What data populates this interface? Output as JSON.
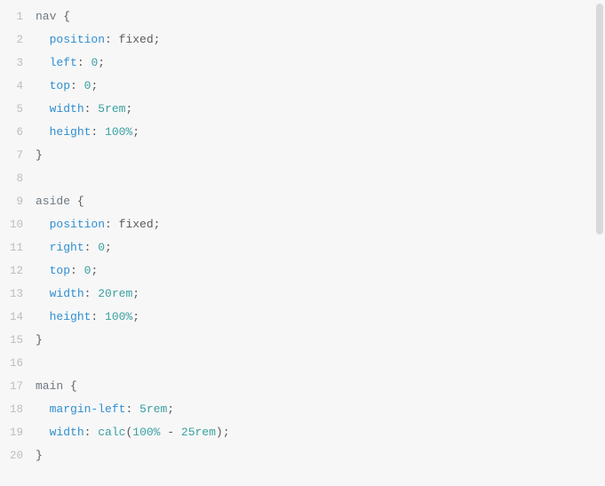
{
  "lines": [
    {
      "num": "1",
      "tokens": [
        {
          "t": "nav",
          "c": "tok-selector"
        },
        {
          "t": " {",
          "c": "tok-punc"
        }
      ]
    },
    {
      "num": "2",
      "tokens": [
        {
          "t": "  ",
          "c": ""
        },
        {
          "t": "position",
          "c": "tok-prop"
        },
        {
          "t": ": ",
          "c": "tok-punc"
        },
        {
          "t": "fixed",
          "c": "tok-value"
        },
        {
          "t": ";",
          "c": "tok-punc"
        }
      ]
    },
    {
      "num": "3",
      "tokens": [
        {
          "t": "  ",
          "c": ""
        },
        {
          "t": "left",
          "c": "tok-prop"
        },
        {
          "t": ": ",
          "c": "tok-punc"
        },
        {
          "t": "0",
          "c": "tok-number"
        },
        {
          "t": ";",
          "c": "tok-punc"
        }
      ]
    },
    {
      "num": "4",
      "tokens": [
        {
          "t": "  ",
          "c": ""
        },
        {
          "t": "top",
          "c": "tok-prop"
        },
        {
          "t": ": ",
          "c": "tok-punc"
        },
        {
          "t": "0",
          "c": "tok-number"
        },
        {
          "t": ";",
          "c": "tok-punc"
        }
      ]
    },
    {
      "num": "5",
      "tokens": [
        {
          "t": "  ",
          "c": ""
        },
        {
          "t": "width",
          "c": "tok-prop"
        },
        {
          "t": ": ",
          "c": "tok-punc"
        },
        {
          "t": "5rem",
          "c": "tok-number"
        },
        {
          "t": ";",
          "c": "tok-punc"
        }
      ]
    },
    {
      "num": "6",
      "tokens": [
        {
          "t": "  ",
          "c": ""
        },
        {
          "t": "height",
          "c": "tok-prop"
        },
        {
          "t": ": ",
          "c": "tok-punc"
        },
        {
          "t": "100%",
          "c": "tok-number"
        },
        {
          "t": ";",
          "c": "tok-punc"
        }
      ]
    },
    {
      "num": "7",
      "tokens": [
        {
          "t": "}",
          "c": "tok-punc"
        }
      ]
    },
    {
      "num": "8",
      "tokens": []
    },
    {
      "num": "9",
      "tokens": [
        {
          "t": "aside",
          "c": "tok-selector"
        },
        {
          "t": " {",
          "c": "tok-punc"
        }
      ]
    },
    {
      "num": "10",
      "tokens": [
        {
          "t": "  ",
          "c": ""
        },
        {
          "t": "position",
          "c": "tok-prop"
        },
        {
          "t": ": ",
          "c": "tok-punc"
        },
        {
          "t": "fixed",
          "c": "tok-value"
        },
        {
          "t": ";",
          "c": "tok-punc"
        }
      ]
    },
    {
      "num": "11",
      "tokens": [
        {
          "t": "  ",
          "c": ""
        },
        {
          "t": "right",
          "c": "tok-prop"
        },
        {
          "t": ": ",
          "c": "tok-punc"
        },
        {
          "t": "0",
          "c": "tok-number"
        },
        {
          "t": ";",
          "c": "tok-punc"
        }
      ]
    },
    {
      "num": "12",
      "tokens": [
        {
          "t": "  ",
          "c": ""
        },
        {
          "t": "top",
          "c": "tok-prop"
        },
        {
          "t": ": ",
          "c": "tok-punc"
        },
        {
          "t": "0",
          "c": "tok-number"
        },
        {
          "t": ";",
          "c": "tok-punc"
        }
      ]
    },
    {
      "num": "13",
      "tokens": [
        {
          "t": "  ",
          "c": ""
        },
        {
          "t": "width",
          "c": "tok-prop"
        },
        {
          "t": ": ",
          "c": "tok-punc"
        },
        {
          "t": "20rem",
          "c": "tok-number"
        },
        {
          "t": ";",
          "c": "tok-punc"
        }
      ]
    },
    {
      "num": "14",
      "tokens": [
        {
          "t": "  ",
          "c": ""
        },
        {
          "t": "height",
          "c": "tok-prop"
        },
        {
          "t": ": ",
          "c": "tok-punc"
        },
        {
          "t": "100%",
          "c": "tok-number"
        },
        {
          "t": ";",
          "c": "tok-punc"
        }
      ]
    },
    {
      "num": "15",
      "tokens": [
        {
          "t": "}",
          "c": "tok-punc"
        }
      ]
    },
    {
      "num": "16",
      "tokens": []
    },
    {
      "num": "17",
      "tokens": [
        {
          "t": "main",
          "c": "tok-selector"
        },
        {
          "t": " {",
          "c": "tok-punc"
        }
      ]
    },
    {
      "num": "18",
      "tokens": [
        {
          "t": "  ",
          "c": ""
        },
        {
          "t": "margin-left",
          "c": "tok-prop"
        },
        {
          "t": ": ",
          "c": "tok-punc"
        },
        {
          "t": "5rem",
          "c": "tok-number"
        },
        {
          "t": ";",
          "c": "tok-punc"
        }
      ]
    },
    {
      "num": "19",
      "tokens": [
        {
          "t": "  ",
          "c": ""
        },
        {
          "t": "width",
          "c": "tok-prop"
        },
        {
          "t": ": ",
          "c": "tok-punc"
        },
        {
          "t": "calc",
          "c": "tok-func"
        },
        {
          "t": "(",
          "c": "tok-punc"
        },
        {
          "t": "100%",
          "c": "tok-number"
        },
        {
          "t": " - ",
          "c": "tok-punc"
        },
        {
          "t": "25rem",
          "c": "tok-number"
        },
        {
          "t": ")",
          "c": "tok-punc"
        },
        {
          "t": ";",
          "c": "tok-punc"
        }
      ]
    },
    {
      "num": "20",
      "tokens": [
        {
          "t": "}",
          "c": "tok-punc"
        }
      ]
    }
  ]
}
